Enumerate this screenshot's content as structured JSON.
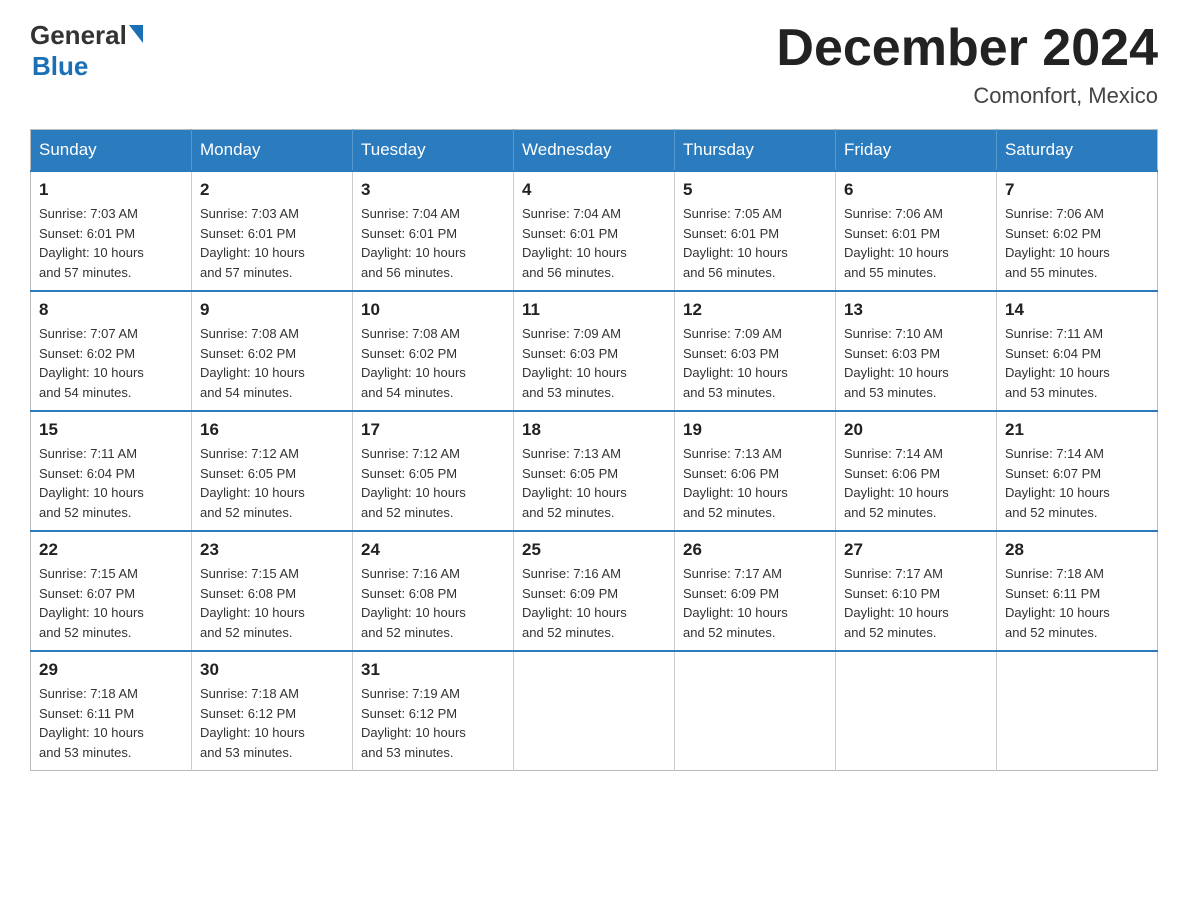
{
  "header": {
    "logo_general": "General",
    "logo_blue": "Blue",
    "title": "December 2024",
    "subtitle": "Comonfort, Mexico"
  },
  "calendar": {
    "days_of_week": [
      "Sunday",
      "Monday",
      "Tuesday",
      "Wednesday",
      "Thursday",
      "Friday",
      "Saturday"
    ],
    "weeks": [
      [
        {
          "day": "1",
          "sunrise": "7:03 AM",
          "sunset": "6:01 PM",
          "daylight": "10 hours and 57 minutes."
        },
        {
          "day": "2",
          "sunrise": "7:03 AM",
          "sunset": "6:01 PM",
          "daylight": "10 hours and 57 minutes."
        },
        {
          "day": "3",
          "sunrise": "7:04 AM",
          "sunset": "6:01 PM",
          "daylight": "10 hours and 56 minutes."
        },
        {
          "day": "4",
          "sunrise": "7:04 AM",
          "sunset": "6:01 PM",
          "daylight": "10 hours and 56 minutes."
        },
        {
          "day": "5",
          "sunrise": "7:05 AM",
          "sunset": "6:01 PM",
          "daylight": "10 hours and 56 minutes."
        },
        {
          "day": "6",
          "sunrise": "7:06 AM",
          "sunset": "6:01 PM",
          "daylight": "10 hours and 55 minutes."
        },
        {
          "day": "7",
          "sunrise": "7:06 AM",
          "sunset": "6:02 PM",
          "daylight": "10 hours and 55 minutes."
        }
      ],
      [
        {
          "day": "8",
          "sunrise": "7:07 AM",
          "sunset": "6:02 PM",
          "daylight": "10 hours and 54 minutes."
        },
        {
          "day": "9",
          "sunrise": "7:08 AM",
          "sunset": "6:02 PM",
          "daylight": "10 hours and 54 minutes."
        },
        {
          "day": "10",
          "sunrise": "7:08 AM",
          "sunset": "6:02 PM",
          "daylight": "10 hours and 54 minutes."
        },
        {
          "day": "11",
          "sunrise": "7:09 AM",
          "sunset": "6:03 PM",
          "daylight": "10 hours and 53 minutes."
        },
        {
          "day": "12",
          "sunrise": "7:09 AM",
          "sunset": "6:03 PM",
          "daylight": "10 hours and 53 minutes."
        },
        {
          "day": "13",
          "sunrise": "7:10 AM",
          "sunset": "6:03 PM",
          "daylight": "10 hours and 53 minutes."
        },
        {
          "day": "14",
          "sunrise": "7:11 AM",
          "sunset": "6:04 PM",
          "daylight": "10 hours and 53 minutes."
        }
      ],
      [
        {
          "day": "15",
          "sunrise": "7:11 AM",
          "sunset": "6:04 PM",
          "daylight": "10 hours and 52 minutes."
        },
        {
          "day": "16",
          "sunrise": "7:12 AM",
          "sunset": "6:05 PM",
          "daylight": "10 hours and 52 minutes."
        },
        {
          "day": "17",
          "sunrise": "7:12 AM",
          "sunset": "6:05 PM",
          "daylight": "10 hours and 52 minutes."
        },
        {
          "day": "18",
          "sunrise": "7:13 AM",
          "sunset": "6:05 PM",
          "daylight": "10 hours and 52 minutes."
        },
        {
          "day": "19",
          "sunrise": "7:13 AM",
          "sunset": "6:06 PM",
          "daylight": "10 hours and 52 minutes."
        },
        {
          "day": "20",
          "sunrise": "7:14 AM",
          "sunset": "6:06 PM",
          "daylight": "10 hours and 52 minutes."
        },
        {
          "day": "21",
          "sunrise": "7:14 AM",
          "sunset": "6:07 PM",
          "daylight": "10 hours and 52 minutes."
        }
      ],
      [
        {
          "day": "22",
          "sunrise": "7:15 AM",
          "sunset": "6:07 PM",
          "daylight": "10 hours and 52 minutes."
        },
        {
          "day": "23",
          "sunrise": "7:15 AM",
          "sunset": "6:08 PM",
          "daylight": "10 hours and 52 minutes."
        },
        {
          "day": "24",
          "sunrise": "7:16 AM",
          "sunset": "6:08 PM",
          "daylight": "10 hours and 52 minutes."
        },
        {
          "day": "25",
          "sunrise": "7:16 AM",
          "sunset": "6:09 PM",
          "daylight": "10 hours and 52 minutes."
        },
        {
          "day": "26",
          "sunrise": "7:17 AM",
          "sunset": "6:09 PM",
          "daylight": "10 hours and 52 minutes."
        },
        {
          "day": "27",
          "sunrise": "7:17 AM",
          "sunset": "6:10 PM",
          "daylight": "10 hours and 52 minutes."
        },
        {
          "day": "28",
          "sunrise": "7:18 AM",
          "sunset": "6:11 PM",
          "daylight": "10 hours and 52 minutes."
        }
      ],
      [
        {
          "day": "29",
          "sunrise": "7:18 AM",
          "sunset": "6:11 PM",
          "daylight": "10 hours and 53 minutes."
        },
        {
          "day": "30",
          "sunrise": "7:18 AM",
          "sunset": "6:12 PM",
          "daylight": "10 hours and 53 minutes."
        },
        {
          "day": "31",
          "sunrise": "7:19 AM",
          "sunset": "6:12 PM",
          "daylight": "10 hours and 53 minutes."
        },
        null,
        null,
        null,
        null
      ]
    ],
    "label_sunrise": "Sunrise:",
    "label_sunset": "Sunset:",
    "label_daylight": "Daylight:"
  }
}
